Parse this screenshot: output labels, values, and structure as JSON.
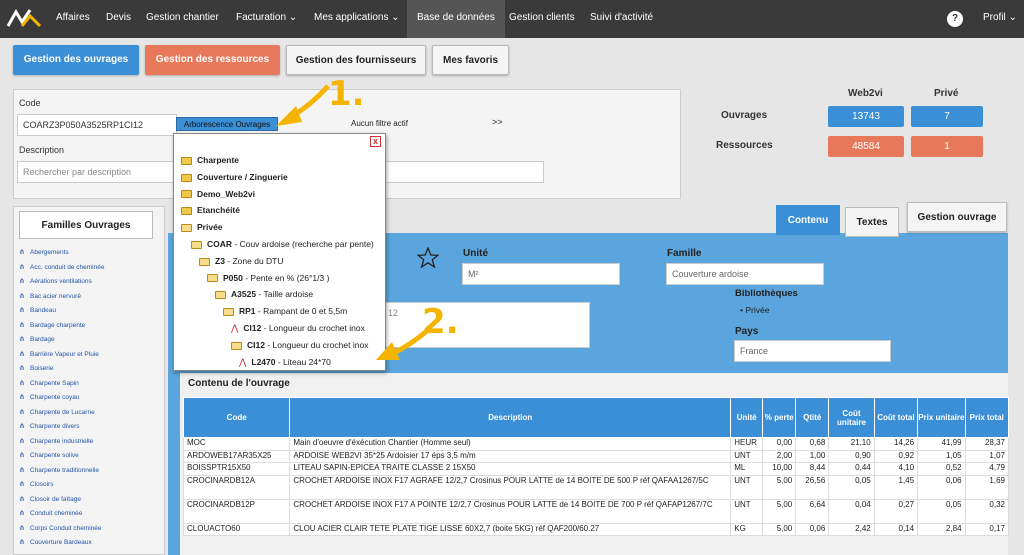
{
  "nav": {
    "items": [
      "Affaires",
      "Devis",
      "Gestion chantier",
      "Facturation ⌄",
      "Mes applications ⌄",
      "Base de données",
      "Gestion clients",
      "Suivi d'activité"
    ],
    "profile": "Profil ⌄",
    "help": "?"
  },
  "tabs": {
    "ouvrages": "Gestion des ouvrages",
    "ressources": "Gestion des ressources",
    "fournisseurs": "Gestion des fournisseurs",
    "favoris": "Mes favoris"
  },
  "filter": {
    "code_label": "Code",
    "code_value": "COARZ3P050A3525RP1CI12",
    "arbo_button": "Arborescence Ouvrages",
    "filter_status": "Aucun filtre actif",
    "arrows": ">>",
    "description_label": "Description",
    "description_placeholder": "Rechercher par description"
  },
  "stats": {
    "col_web2vi": "Web2vi",
    "col_prive": "Privé",
    "row_ouvrages": "Ouvrages",
    "row_ressources": "Ressources",
    "ouvrages_web2vi": "13743",
    "ouvrages_prive": "7",
    "ressources_web2vi": "48584",
    "ressources_prive": "1"
  },
  "sidebar": {
    "title": "Familles Ouvrages",
    "items": [
      "Abergements",
      "Acc. conduit de cheminée",
      "Aérations ventilations",
      "Bac acier nervuré",
      "Bandeau",
      "Bardage charpente",
      "Bardage",
      "Barrière Vapeur et Pluie",
      "Boiserie",
      "Charpente Sapin",
      "Charpente coyau",
      "Charpente de Lucarne",
      "Charpente divers",
      "Charpente industrielle",
      "Charpente solive",
      "Charpente traditionnelle",
      "Closoirs",
      "Closoir de faîtage",
      "Conduit cheminée",
      "Corps Conduit cheminée",
      "Couverture Bardeaux"
    ]
  },
  "detail": {
    "tab_contenu": "Contenu",
    "tab_textes": "Textes",
    "gestion_ouvrage": "Gestion ouvrage",
    "unite_label": "Unité",
    "unite_value": "M²",
    "famille_label": "Famille",
    "famille_value": "Couverture ardoise",
    "bibliotheques_label": "Bibliothèques",
    "bibliotheque_item": "Privée",
    "pays_label": "Pays",
    "pays_value": "France",
    "partial_value": "12",
    "contenu_title": "Contenu de l'ouvrage"
  },
  "table": {
    "headers": [
      "Code",
      "Description",
      "Unité",
      "% perte",
      "Qtité",
      "Coût unitaire",
      "Coût total",
      "Prix unitaire",
      "Prix total"
    ],
    "rows": [
      [
        "MOC",
        "Main d'oeuvre d'éxécution Chantier (Homme seul)",
        "HEUR",
        "0,00",
        "0,68",
        "21,10",
        "14,26",
        "41,99",
        "28,37"
      ],
      [
        "ARDOWEB17AR35X25",
        "ARDOISE WEB2VI 35*25 Ardoisier 17 éps 3,5 m/m",
        "UNT",
        "2,00",
        "1,00",
        "0,90",
        "0,92",
        "1,05",
        "1,07"
      ],
      [
        "BOISSPTR15X50",
        "LITEAU SAPIN-EPICEA TRAITE CLASSE 2 15X50",
        "ML",
        "10,00",
        "8,44",
        "0,44",
        "4,10",
        "0,52",
        "4,79"
      ],
      [
        "CROCINARDB12A",
        "CROCHET ARDOISE INOX F17 AGRAFE 12/2,7 Crosinus POUR LATTE de 14 BOITE DE 500 P réf QAFAA1267/5C",
        "UNT",
        "5,00",
        "26,56",
        "0,05",
        "1,45",
        "0,06",
        "1,69"
      ],
      [
        "CROCINARDB12P",
        "CROCHET ARDOISE INOX F17 A POINTE 12/2,7 Crosinus POUR LATTE de 14 BOITE DE 700 P réf QAFAP1267/7C",
        "UNT",
        "5,00",
        "6,64",
        "0,04",
        "0,27",
        "0,05",
        "0,32"
      ],
      [
        "CLOUACTO60",
        "CLOU ACIER CLAIR TETE PLATE TIGE LISSE 60X2,7 (boite 5KG) réf QAF200/60.27",
        "KG",
        "5,00",
        "0,06",
        "2,42",
        "0,14",
        "2,84",
        "0,17"
      ]
    ]
  },
  "tree": {
    "close": "x",
    "nodes": [
      {
        "label": "Charpente",
        "extra": ""
      },
      {
        "label": "Couverture / Zinguerie",
        "extra": ""
      },
      {
        "label": "Demo_Web2vi",
        "extra": ""
      },
      {
        "label": "Etanchéité",
        "extra": ""
      },
      {
        "label": "Privée",
        "extra": ""
      },
      {
        "label": "COAR",
        "extra": " - Couv ardoise (recherche par pente)"
      },
      {
        "label": "Z3",
        "extra": " - Zone du DTU"
      },
      {
        "label": "P050",
        "extra": " - Pente en % (26°1/3 )"
      },
      {
        "label": "A3525",
        "extra": " - Taille ardoise"
      },
      {
        "label": "RP1",
        "extra": " - Rampant de 0 et 5,5m"
      },
      {
        "label": "CI12",
        "extra": " - Longueur du crochet inox"
      },
      {
        "label": "CI12",
        "extra": " - Longueur du crochet inox"
      },
      {
        "label": "L2470",
        "extra": " - Liteau 24*70"
      }
    ]
  },
  "annotations": {
    "one": "1.",
    "two": "2."
  },
  "colors": {
    "accent_blue": "#3a8fd6",
    "orange": "#e8785a",
    "arrow": "#f5b400"
  }
}
